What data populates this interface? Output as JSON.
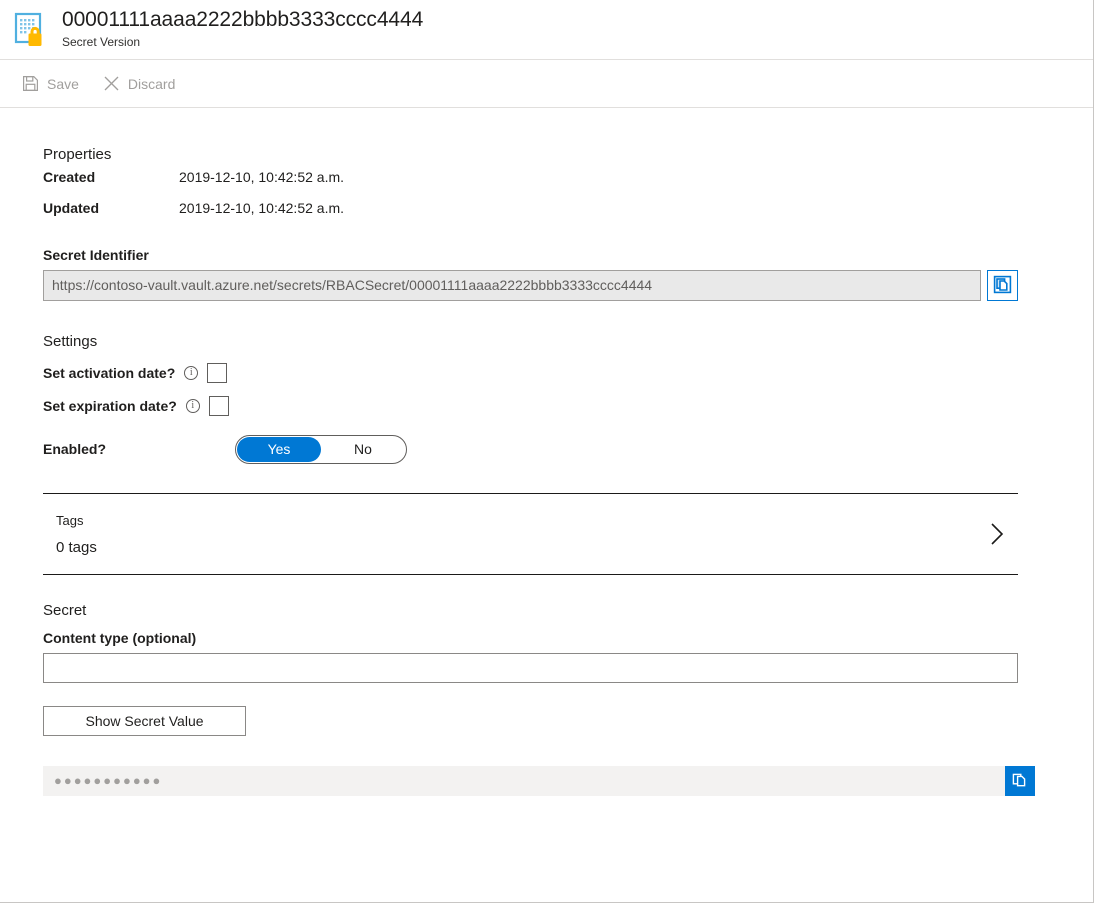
{
  "header": {
    "title": "00001111aaaa2222bbbb3333cccc4444",
    "subtitle": "Secret Version",
    "icon": "secret-key-lock-icon"
  },
  "toolbar": {
    "save_label": "Save",
    "save_icon": "save-floppy-icon",
    "discard_label": "Discard",
    "discard_icon": "close-x-icon"
  },
  "properties": {
    "section_title": "Properties",
    "rows": [
      {
        "key": "Created",
        "value": "2019-12-10, 10:42:52 a.m."
      },
      {
        "key": "Updated",
        "value": "2019-12-10, 10:42:52 a.m."
      }
    ],
    "identifier_label": "Secret Identifier",
    "identifier_value": "https://contoso-vault.vault.azure.net/secrets/RBACSecret/00001111aaaa2222bbbb3333cccc4444",
    "copy_identifier_icon": "copy-icon"
  },
  "settings": {
    "section_title": "Settings",
    "activation_label": "Set activation date?",
    "activation_checked": false,
    "expiration_label": "Set expiration date?",
    "expiration_checked": false,
    "info_icon": "info-icon",
    "enabled_label": "Enabled?",
    "enabled_yes": "Yes",
    "enabled_no": "No",
    "enabled_selected": "Yes"
  },
  "tags": {
    "label": "Tags",
    "value": "0 tags",
    "chevron_icon": "chevron-right-icon"
  },
  "secret": {
    "section_title": "Secret",
    "content_type_label": "Content type (optional)",
    "content_type_value": "",
    "content_type_placeholder": "",
    "show_secret_button": "Show Secret Value",
    "masked_value": "●●●●●●●●●●●",
    "copy_secret_icon": "copy-icon"
  },
  "colors": {
    "accent": "#0078d4",
    "lock": "#ffb900",
    "doc": "#50b0e0",
    "disabled_text": "#a19f9d",
    "readonly_bg": "#e9e9e9",
    "masked_bg": "#f3f2f1"
  }
}
